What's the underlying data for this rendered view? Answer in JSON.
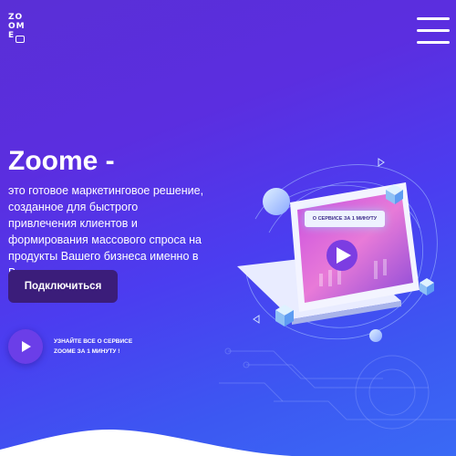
{
  "logo": {
    "text_line1": "ZO",
    "text_line2": "OM",
    "text_line3": "E"
  },
  "header": {
    "menu_icon": "hamburger-menu-icon"
  },
  "hero": {
    "title": "Zoome -",
    "description": "это готовое маркетинговое решение, созданное для быстрого привлечения клиентов и формирования массового спроса на продукты Вашего бизнеса именно в Вашем регионе.",
    "cta_label": "Подключиться"
  },
  "video": {
    "icon": "play-icon",
    "label_line1": "УЗНАЙТЕ ВСЕ О СЕРВИСЕ",
    "label_line2": "ZOOME ЗА 1 МИНУТУ !"
  },
  "illustration": {
    "badge_label": "О СЕРВИСЕ ЗА 1 МИНУТУ",
    "icon": "laptop-video-illustration"
  },
  "colors": {
    "bg_top": "#5a2fd6",
    "bg_bottom": "#3a6af5",
    "cta_bg": "#3b1d7a",
    "play_bg": "#6b3ee8",
    "badge_bg": "#eef2ff"
  }
}
